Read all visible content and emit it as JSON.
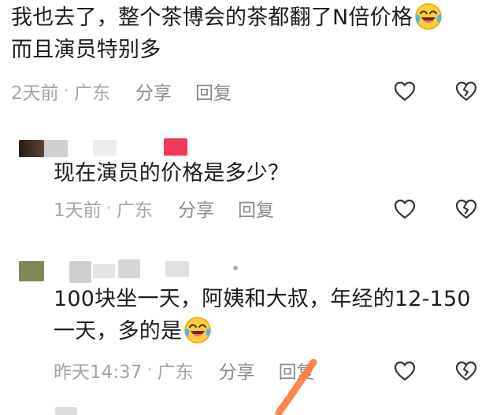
{
  "comments": [
    {
      "text_line1": "我也去了，整个茶博会的茶都翻了N倍价格",
      "text_line2": "而且演员特别多",
      "time": "2天前",
      "separator": "·",
      "location": "广东",
      "share_label": "分享",
      "reply_label": "回复",
      "emoji": "laughing-crying-emoji"
    },
    {
      "text_line1": "现在演员的价格是多少？",
      "time": "1天前",
      "separator": "·",
      "location": "广东",
      "share_label": "分享",
      "reply_label": "回复"
    },
    {
      "text_line1": "100块坐一天，阿姨和大叔，年经的12-150",
      "text_line2": "一天，多的是",
      "time": "昨天14:37",
      "separator": "·",
      "location": "广东",
      "share_label": "分享",
      "reply_label": "回复",
      "emoji": "laughing-crying-emoji"
    }
  ],
  "icons": {
    "like": "heart-outline-icon",
    "dislike": "broken-heart-outline-icon"
  },
  "colors": {
    "text": "#1c1c1c",
    "meta": "#8d8d8d",
    "icon": "#333333",
    "avatar_blur_accent": "#f0385a",
    "annotation_stroke": "#ff7a3c"
  }
}
